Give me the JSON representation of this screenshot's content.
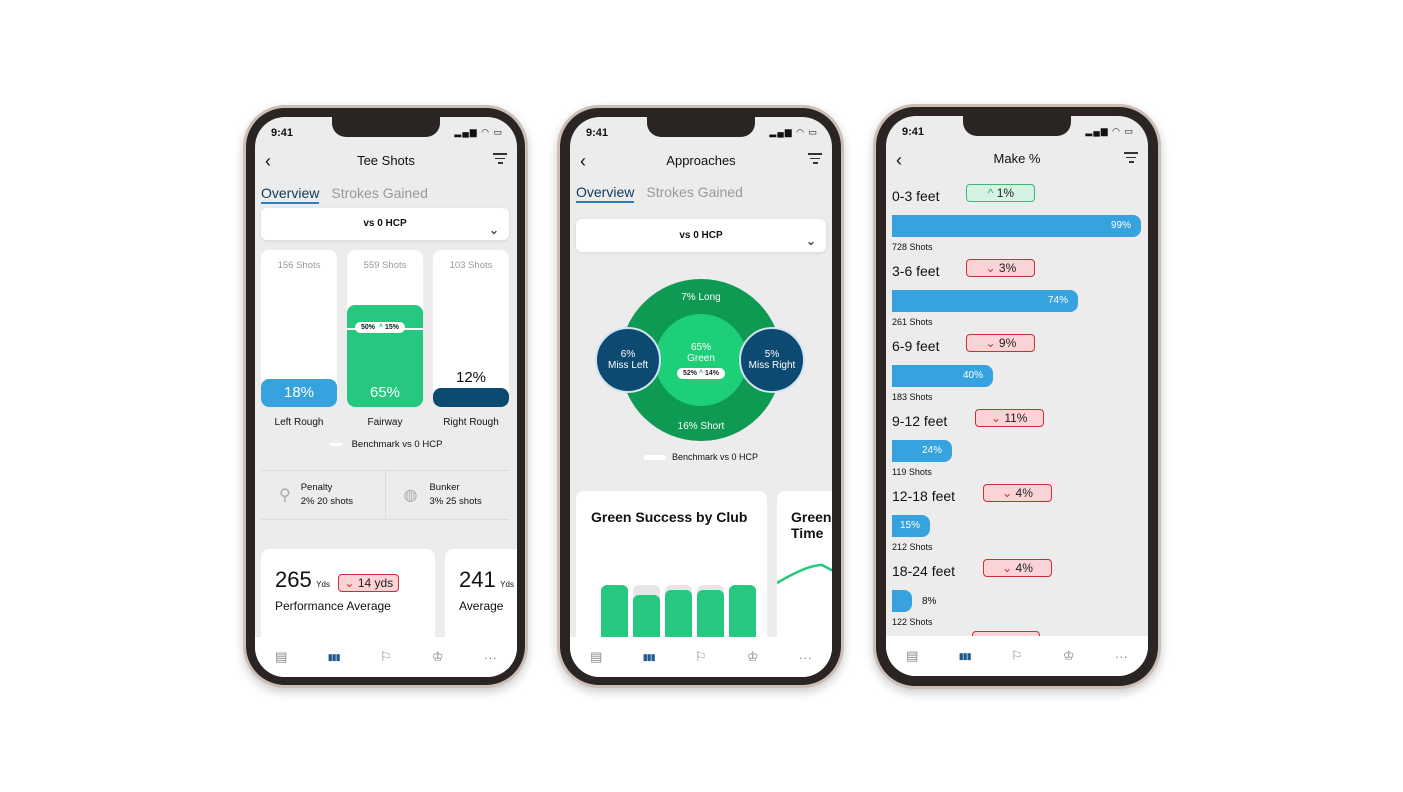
{
  "status_time": "9:41",
  "tabbar": {
    "icons": [
      "scorecard-icon",
      "stats-icon",
      "flag-icon",
      "trophy-icon",
      "more-icon"
    ],
    "active": 1
  },
  "tee": {
    "title": "Tee Shots",
    "tabs": [
      "Overview",
      "Strokes Gained"
    ],
    "dropdown": "vs 0 HCP",
    "cards": [
      {
        "shots": "156 Shots",
        "pct": "18%",
        "value": 18,
        "label": "Left Rough",
        "color": "#36a3de"
      },
      {
        "shots": "559 Shots",
        "pct": "65%",
        "value": 65,
        "label": "Fairway",
        "color": "#26c77f",
        "benchmark": "50%",
        "delta": "15%"
      },
      {
        "shots": "103 Shots",
        "pct": "12%",
        "value": 12,
        "label": "Right Rough",
        "color": "#0d4a72"
      }
    ],
    "legend": "Benchmark vs 0 HCP",
    "penalty": {
      "title": "Penalty",
      "value": "2% 20 shots"
    },
    "bunker": {
      "title": "Bunker",
      "value": "3% 25 shots"
    },
    "perf": {
      "value": "265",
      "unit": "Yds",
      "delta": "14 yds",
      "label": "Performance Average"
    },
    "avg": {
      "value": "241",
      "unit": "Yds",
      "label": "Average"
    }
  },
  "approach": {
    "title": "Approaches",
    "tabs": [
      "Overview",
      "Strokes Gained"
    ],
    "dropdown": "vs 0 HCP",
    "long": "7% Long",
    "short": "16% Short",
    "green": {
      "pct": "65%",
      "label": "Green",
      "benchmark": "52%",
      "delta": "14%"
    },
    "left": {
      "pct": "6%",
      "label": "Miss Left"
    },
    "right": {
      "pct": "5%",
      "label": "Miss Right"
    },
    "legend": "Benchmark vs 0 HCP",
    "card1_title": "Green Success by Club",
    "card2_title": "Green Time",
    "club_bars": [
      {
        "value": 80,
        "bench": 80
      },
      {
        "value": 65,
        "bench": 80
      },
      {
        "value": 72,
        "bench": 80
      },
      {
        "value": 72,
        "bench": 80
      },
      {
        "value": 80,
        "bench": 80
      }
    ]
  },
  "make": {
    "title": "Make %",
    "rows": [
      {
        "label": "0-3 feet",
        "delta": "1%",
        "dir": "up",
        "pct": "99%",
        "value": 99,
        "shots": "728 Shots"
      },
      {
        "label": "3-6 feet",
        "delta": "3%",
        "dir": "down",
        "pct": "74%",
        "value": 74,
        "shots": "261 Shots"
      },
      {
        "label": "6-9 feet",
        "delta": "9%",
        "dir": "down",
        "pct": "40%",
        "value": 40,
        "shots": "183 Shots"
      },
      {
        "label": "9-12 feet",
        "delta": "11%",
        "dir": "down",
        "pct": "24%",
        "value": 24,
        "shots": "119 Shots"
      },
      {
        "label": "12-18 feet",
        "delta": "4%",
        "dir": "down",
        "pct": "15%",
        "value": 15,
        "shots": "212 Shots"
      },
      {
        "label": "18-24 feet",
        "delta": "4%",
        "dir": "down",
        "pct": "8%",
        "value": 8,
        "shots": "122 Shots"
      }
    ]
  }
}
